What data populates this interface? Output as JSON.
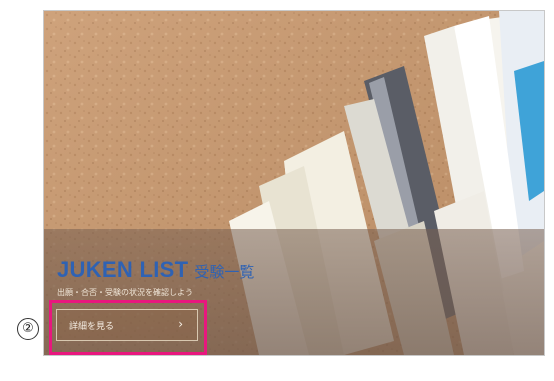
{
  "banner": {
    "title_en": "JUKEN LIST",
    "title_ja": "受験一覧",
    "subtitle": "出願・合否・受験の状況を確認しよう",
    "detail_button_label": "詳細を見る",
    "detail_button_arrow": "›"
  },
  "annotation": {
    "step_marker": "②",
    "highlight_color": "#e8177e"
  },
  "colors": {
    "title": "#2f62b3",
    "background": "#c8956a"
  },
  "icons": {
    "detail_arrow": "chevron-right-icon"
  }
}
